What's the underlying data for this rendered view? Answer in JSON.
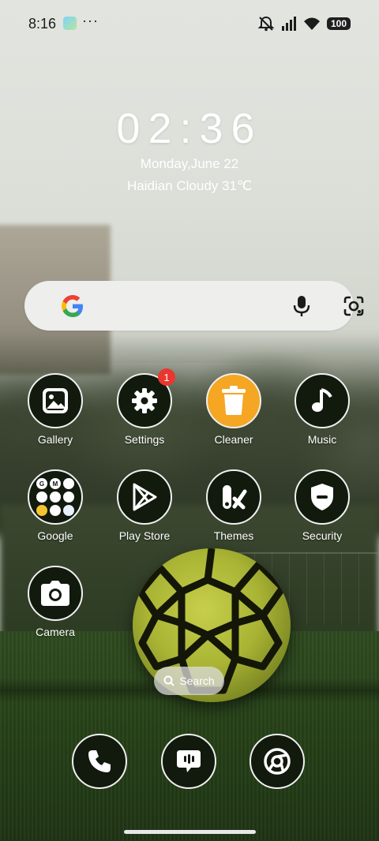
{
  "status_bar": {
    "time": "8:16",
    "more": "···",
    "battery": "100"
  },
  "clock": {
    "time": "02:36",
    "date": "Monday,June 22",
    "weather": "Haidian Cloudy 31℃"
  },
  "search_widget": {
    "icons": [
      "google-logo-icon",
      "mic-icon",
      "lens-icon"
    ]
  },
  "apps": [
    {
      "label": "Gallery",
      "icon": "gallery-icon"
    },
    {
      "label": "Settings",
      "icon": "gear-icon",
      "badge": "1"
    },
    {
      "label": "Cleaner",
      "icon": "trash-icon"
    },
    {
      "label": "Music",
      "icon": "music-note-icon"
    },
    {
      "label": "Google",
      "icon": "folder-icon",
      "folder_glyphs": [
        "G",
        "M",
        "",
        "",
        "",
        "",
        "",
        "",
        ""
      ]
    },
    {
      "label": "Play Store",
      "icon": "play-icon"
    },
    {
      "label": "Themes",
      "icon": "themes-icon"
    },
    {
      "label": "Security",
      "icon": "shield-icon"
    },
    {
      "label": "Camera",
      "icon": "camera-icon"
    }
  ],
  "search_pill": {
    "label": "Search"
  },
  "dock": [
    {
      "icon": "phone-icon"
    },
    {
      "icon": "messages-icon"
    },
    {
      "icon": "chrome-icon"
    }
  ],
  "colors": {
    "icon_bg": "#111a0d",
    "cleaner_bg": "#f5a623",
    "badge": "#e8372f"
  }
}
